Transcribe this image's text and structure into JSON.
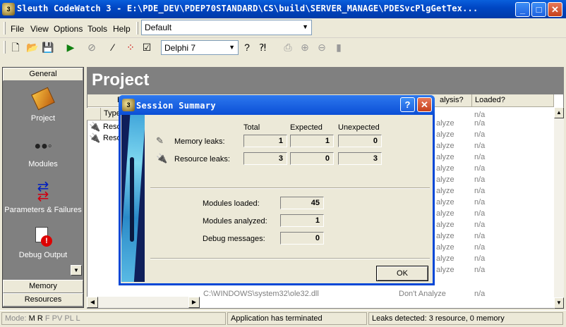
{
  "window": {
    "title": "Sleuth CodeWatch 3 - E:\\PDE_DEV\\PDEP70STANDARD\\CS\\build\\SERVER_MANAGE\\PDESvcPlgGetTex...",
    "minimize": "_",
    "maximize": "□",
    "close": "✕"
  },
  "menu": {
    "file": "File",
    "view": "View",
    "options": "Options",
    "tools": "Tools",
    "help": "Help"
  },
  "profile_select": {
    "value": "Default"
  },
  "toolbar": {
    "compiler_select": "Delphi 7",
    "icons": [
      "new-icon",
      "open-icon",
      "save-icon",
      "run-icon",
      "stop-icon",
      "wand-icon",
      "dots-icon",
      "checklist-icon",
      "help-icon",
      "context-help-icon",
      "print-icon",
      "zoom-in-icon",
      "zoom-out-icon",
      "page-icon"
    ]
  },
  "sidebar": {
    "general_tab": "General",
    "items": [
      {
        "label": "Project",
        "icon": "project-book-icon"
      },
      {
        "label": "Modules",
        "icon": "modules-icon"
      },
      {
        "label": "Parameters & Failures",
        "icon": "arrows-icon"
      },
      {
        "label": "Debug Output",
        "icon": "debug-output-icon"
      }
    ],
    "memory_tab": "Memory",
    "resources_tab": "Resources"
  },
  "main": {
    "title": "Project",
    "columns": [
      "Type",
      "alysis?",
      "Loaded?"
    ],
    "col_visible_prefix": "B",
    "rows_left": [
      "Reso",
      "Reso"
    ],
    "analysis_values": [
      "alyze",
      "alyze",
      "alyze",
      "alyze",
      "alyze",
      "alyze",
      "alyze",
      "alyze",
      "alyze",
      "alyze",
      "alyze",
      "alyze",
      "alyze",
      "alyze"
    ],
    "loaded_value": "n/a",
    "last_row": {
      "path": "C:\\WINDOWS\\system32\\ole32.dll",
      "analysis": "Don't Analyze",
      "loaded": "n/a"
    }
  },
  "status": {
    "mode_label": "Mode:",
    "mode_active": "M R",
    "mode_inactive": "F PV PL L",
    "message": "Application has terminated",
    "leaks": "Leaks detected: 3 resource, 0 memory"
  },
  "dialog": {
    "title": "Session Summary",
    "help": "?",
    "close": "✕",
    "headers": {
      "total": "Total",
      "expected": "Expected",
      "unexpected": "Unexpected"
    },
    "memory_leaks": {
      "label": "Memory leaks:",
      "total": "1",
      "expected": "1",
      "unexpected": "0"
    },
    "resource_leaks": {
      "label": "Resource leaks:",
      "total": "3",
      "expected": "0",
      "unexpected": "3"
    },
    "modules_loaded": {
      "label": "Modules loaded:",
      "value": "45"
    },
    "modules_analyzed": {
      "label": "Modules analyzed:",
      "value": "1"
    },
    "debug_messages": {
      "label": "Debug messages:",
      "value": "0"
    },
    "ok": "OK"
  }
}
